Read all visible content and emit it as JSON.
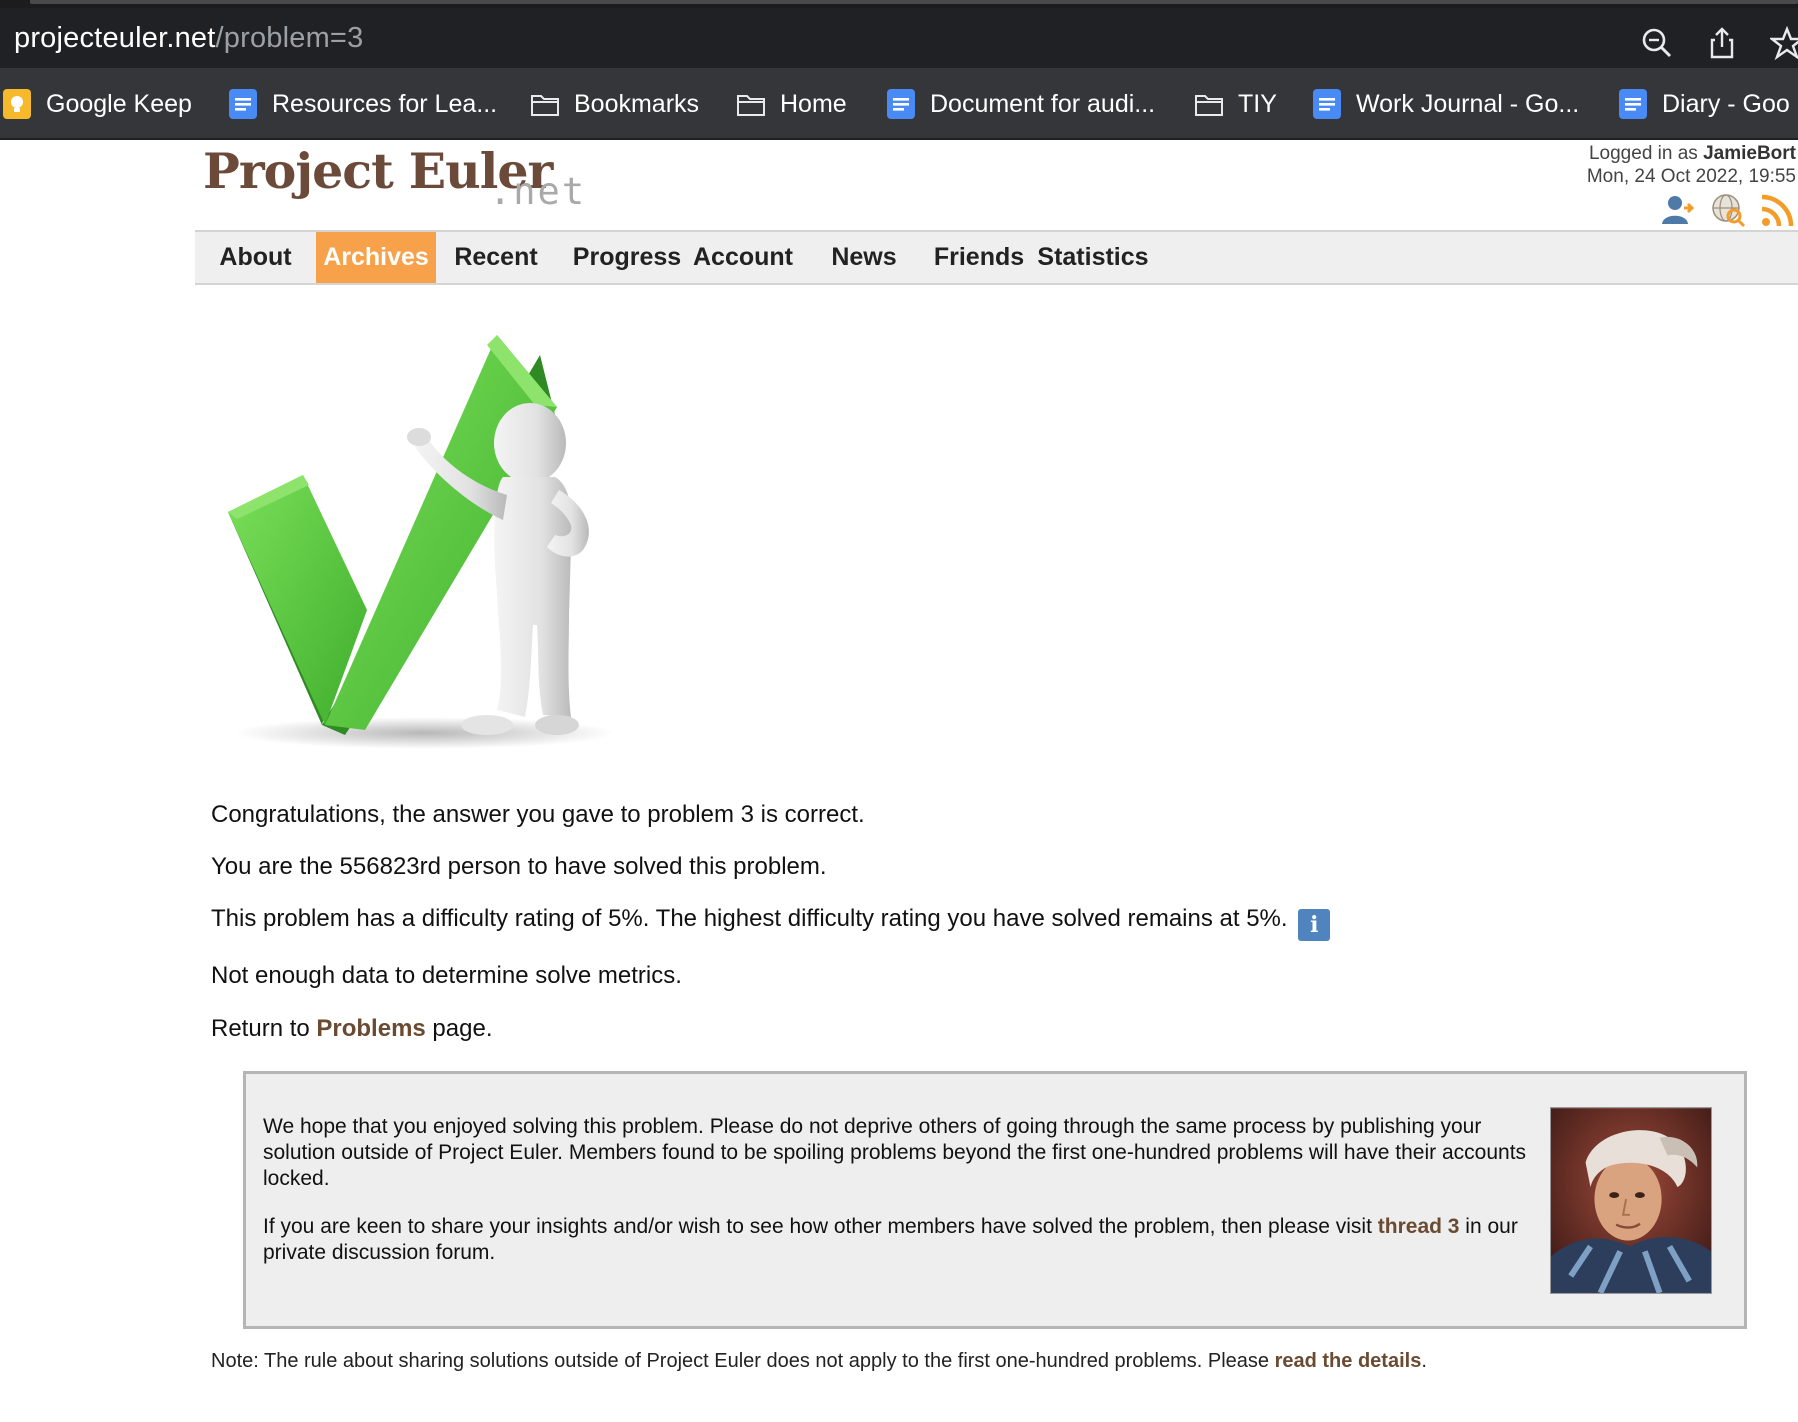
{
  "browser": {
    "url_host": "projecteuler.net",
    "url_path": "/problem=3",
    "bookmarks": [
      {
        "label": "Google Keep",
        "icon": "google-keep-icon"
      },
      {
        "label": "Resources for Lea...",
        "icon": "google-docs-icon"
      },
      {
        "label": "Bookmarks",
        "icon": "folder-icon"
      },
      {
        "label": "Home",
        "icon": "folder-icon"
      },
      {
        "label": "Document for audi...",
        "icon": "google-docs-icon"
      },
      {
        "label": "TIY",
        "icon": "folder-icon"
      },
      {
        "label": "Work Journal - Go...",
        "icon": "google-docs-icon"
      },
      {
        "label": "Diary - Goo",
        "icon": "google-docs-icon"
      }
    ],
    "toolbar_icons": [
      "zoom-icon",
      "share-icon",
      "star-icon"
    ]
  },
  "site": {
    "logo_main": "Project Euler",
    "logo_suffix": ".net",
    "login_prefix": "Logged in as ",
    "username": "JamieBort",
    "datetime": "Mon, 24 Oct 2022, 19:55",
    "header_icons": [
      "account-icon",
      "language-globe-icon",
      "rss-feed-icon"
    ],
    "nav": [
      "About",
      "Archives",
      "Recent",
      "Progress",
      "Account",
      "News",
      "Friends",
      "Statistics"
    ],
    "nav_active": "Archives"
  },
  "result": {
    "congrats": "Congratulations, the answer you gave to problem 3 is correct.",
    "rank": "You are the 556823rd person to have solved this problem.",
    "difficulty": "This problem has a difficulty rating of 5%. The highest difficulty rating you have solved remains at 5%.",
    "info_badge": "i",
    "metrics": "Not enough data to determine solve metrics.",
    "return_prefix": "Return to ",
    "return_link": "Problems",
    "return_suffix": " page."
  },
  "notice": {
    "p1": "We hope that you enjoyed solving this problem. Please do not deprive others of going through the same process by publishing your solution outside of Project Euler. Members found to be spoiling problems beyond the first one-hundred problems will have their accounts locked.",
    "p2_prefix": "If you are keen to share your insights and/or wish to see how other members have solved the problem, then please visit ",
    "p2_link": "thread 3",
    "p2_suffix": " in our private discussion forum."
  },
  "footer_note": {
    "prefix": "Note: The rule about sharing solutions outside of Project Euler does not apply to the first one-hundred problems. Please ",
    "link": "read the details",
    "suffix": "."
  },
  "colors": {
    "brand_brown": "#6b4a3a",
    "nav_active": "#f7a24a",
    "link": "#6b4a32",
    "check_green": "#5cc441"
  }
}
